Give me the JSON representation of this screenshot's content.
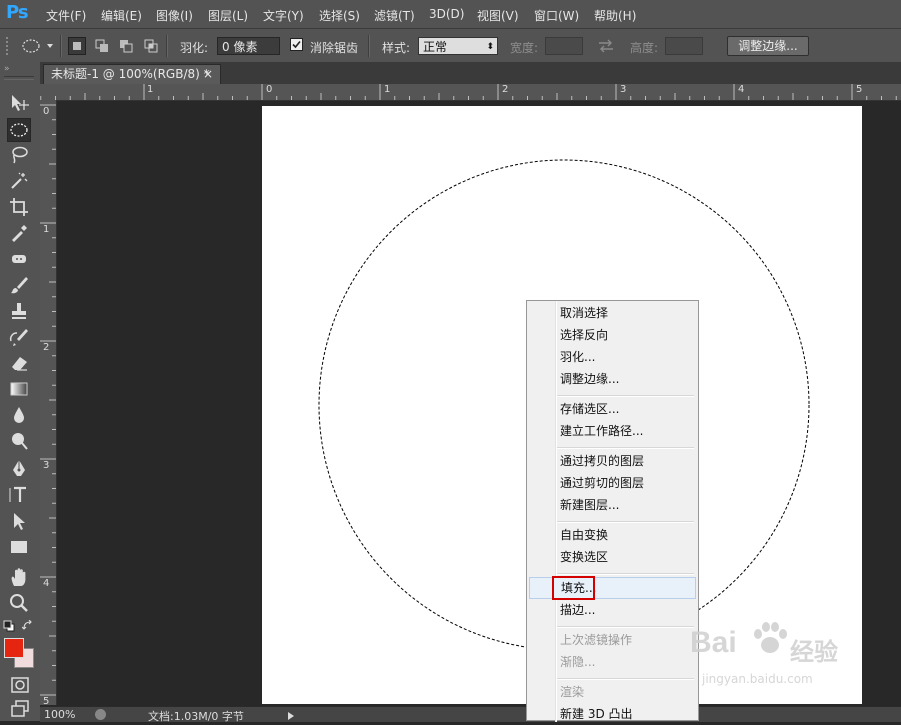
{
  "app": {
    "logo": "Ps"
  },
  "menubar": {
    "items": [
      "文件(F)",
      "编辑(E)",
      "图像(I)",
      "图层(L)",
      "文字(Y)",
      "选择(S)",
      "滤镜(T)",
      "3D(D)",
      "视图(V)",
      "窗口(W)",
      "帮助(H)"
    ]
  },
  "options": {
    "feather_label": "羽化:",
    "feather_value": "0 像素",
    "antialias_label": "消除锯齿",
    "antialias_checked": true,
    "style_label": "样式:",
    "style_value": "正常",
    "width_label": "宽度:",
    "height_label": "高度:",
    "refine_edge_button": "调整边缘..."
  },
  "document": {
    "tab_title": "未标题-1 @ 100%(RGB/8) *",
    "tab_close": "×"
  },
  "rulers": {
    "horizontal": [
      "1",
      "0",
      "1",
      "2",
      "3",
      "4",
      "5"
    ],
    "vertical": [
      "0",
      "1",
      "2",
      "3",
      "4",
      "5"
    ]
  },
  "statusbar": {
    "zoom": "100%",
    "doc_info": "文档:1.03M/0 字节"
  },
  "context_menu": {
    "groups": [
      [
        "取消选择",
        "选择反向",
        "羽化...",
        "调整边缘..."
      ],
      [
        "存储选区...",
        "建立工作路径..."
      ],
      [
        "通过拷贝的图层",
        "通过剪切的图层",
        "新建图层..."
      ],
      [
        "自由变换",
        "变换选区"
      ],
      [
        "填充...",
        "描边..."
      ],
      [
        "上次滤镜操作",
        "渐隐..."
      ],
      [
        "渲染",
        "新建 3D 凸出"
      ]
    ],
    "disabled": [
      "上次滤镜操作",
      "渐隐...",
      "渲染"
    ],
    "highlighted": "填充..."
  },
  "colors": {
    "foreground": "#e52510",
    "background": "#f0dcdc",
    "highlight_box": "#d40000"
  },
  "watermark": {
    "brand": "Bai",
    "brand_suffix": "经验",
    "url": "jingyan.baidu.com"
  }
}
